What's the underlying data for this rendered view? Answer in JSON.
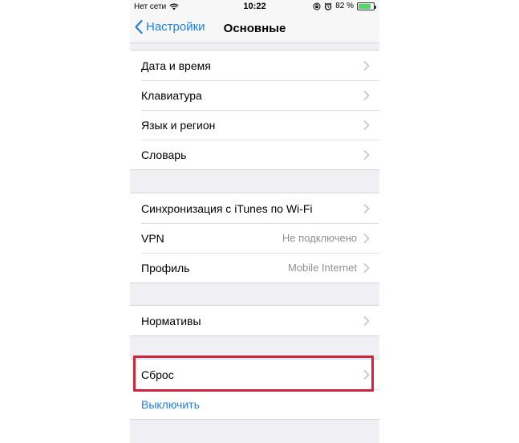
{
  "status_bar": {
    "carrier": "Нет сети",
    "time": "10:22",
    "battery_percent": "82 %",
    "battery_level": 0.82
  },
  "nav": {
    "back_label": "Настройки",
    "title": "Основные"
  },
  "groups": [
    {
      "rows": [
        {
          "label": "Дата и время"
        },
        {
          "label": "Клавиатура"
        },
        {
          "label": "Язык и регион"
        },
        {
          "label": "Словарь"
        }
      ]
    },
    {
      "rows": [
        {
          "label": "Синхронизация с iTunes по Wi-Fi"
        },
        {
          "label": "VPN",
          "value": "Не подключено"
        },
        {
          "label": "Профиль",
          "value": "Mobile Internet"
        }
      ]
    },
    {
      "rows": [
        {
          "label": "Нормативы"
        }
      ]
    },
    {
      "rows": [
        {
          "label": "Сброс"
        },
        {
          "label": "Выключить"
        }
      ]
    }
  ],
  "colors": {
    "accent": "#1f7ee8",
    "highlight": "#d3233c",
    "battery": "#4cd964"
  },
  "icons": {
    "back": "chevron-left-icon",
    "row": "chevron-right-icon",
    "wifi": "wifi-icon",
    "lock": "orientation-lock-icon",
    "alarm": "alarm-icon",
    "battery": "battery-icon"
  }
}
